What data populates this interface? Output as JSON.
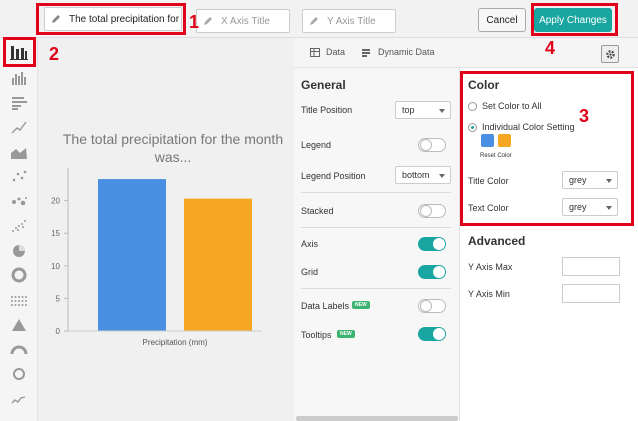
{
  "header": {
    "chart_title_value": "The total precipitation for",
    "x_axis_placeholder": "X Axis Title",
    "y_axis_placeholder": "Y Axis Title",
    "cancel_label": "Cancel",
    "apply_label": "Apply Changes"
  },
  "annotations": [
    "1",
    "2",
    "3",
    "4"
  ],
  "sidebar": {
    "icons": [
      "bar-chart-icon",
      "histogram-icon",
      "horizontal-bar-icon",
      "line-chart-icon",
      "area-chart-icon",
      "scatter-icon",
      "bubble-icon",
      "dot-scatter-icon",
      "pie-chart-icon",
      "donut-chart-icon",
      "grid-dot-icon",
      "triangle-chart-icon",
      "gauge-icon",
      "circle-chart-icon",
      "sparkline-icon"
    ]
  },
  "tabs": {
    "data": "Data",
    "dynamic_data": "Dynamic Data"
  },
  "general": {
    "title": "General",
    "title_position_label": "Title Position",
    "title_position_value": "top",
    "legend_label": "Legend",
    "legend_on": false,
    "legend_position_label": "Legend Position",
    "legend_position_value": "bottom",
    "stacked_label": "Stacked",
    "stacked_on": false,
    "axis_label": "Axis",
    "axis_on": true,
    "grid_label": "Grid",
    "grid_on": true,
    "data_labels_label": "Data Labels",
    "data_labels_on": false,
    "tooltips_label": "Tooltips",
    "tooltips_on": true,
    "new_badge": "NEW"
  },
  "color": {
    "title": "Color",
    "set_all_label": "Set Color to All",
    "individual_label": "Individual Color Setting",
    "reset_label": "Reset Color",
    "title_color_label": "Title Color",
    "title_color_value": "grey",
    "text_color_label": "Text Color",
    "text_color_value": "grey",
    "swatches": [
      "#4a90e2",
      "#f5a623"
    ]
  },
  "advanced": {
    "title": "Advanced",
    "y_max_label": "Y Axis Max",
    "y_min_label": "Y Axis Min"
  },
  "chart_data": {
    "type": "bar",
    "title": "The total precipitation for the month was...",
    "xlabel": "Precipitation (mm)",
    "ylabel": "",
    "categories": [
      "Precipitation (mm)"
    ],
    "series": [
      {
        "values": [
          23.3
        ],
        "color": "#4a90e2"
      },
      {
        "values": [
          20.3
        ],
        "color": "#f5a623"
      }
    ],
    "ylim": [
      0,
      25
    ],
    "yticks": [
      0,
      5,
      10,
      15,
      20
    ],
    "grid": false
  }
}
